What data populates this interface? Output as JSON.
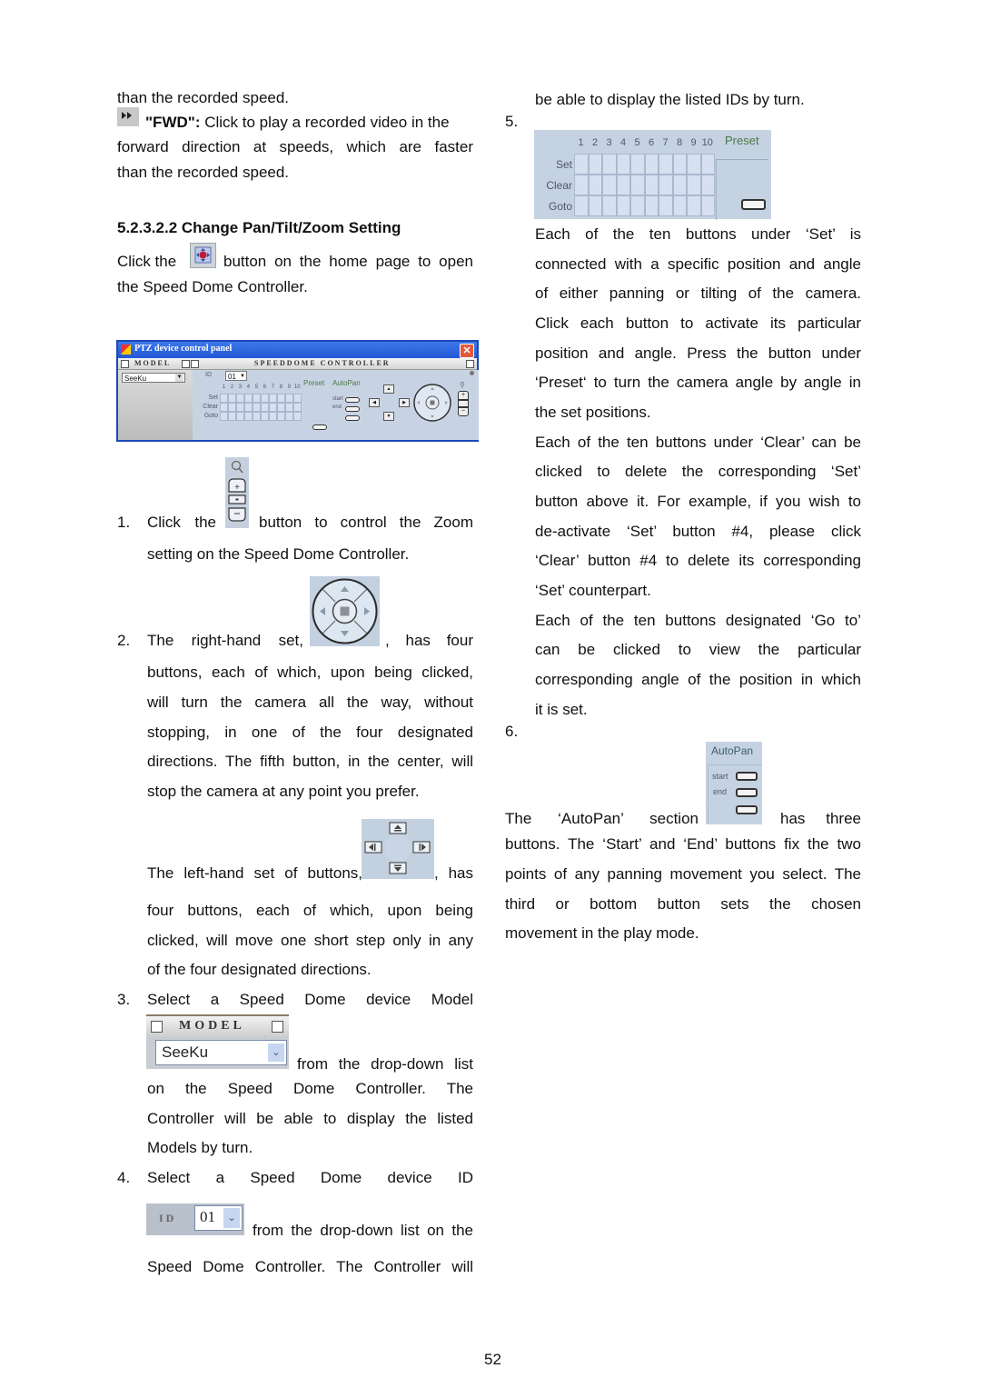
{
  "left_column": {
    "intro_line1": "than the recorded speed.",
    "fwd_label": "\"FWD\":",
    "fwd_line1_rest": " Click to play a recorded video in the",
    "fwd_line2": "forward direction at speeds, which are faster",
    "fwd_line3": "than the recorded speed.",
    "section_heading": "5.2.3.2.2 Change Pan/Tilt/Zoom Setting",
    "click_line1_a": "Click the",
    "click_line1_b": "button on the home page to open",
    "click_line2": "the Speed Dome Controller.",
    "ptz_panel": {
      "window_title": "PTZ device control panel",
      "close_glyph": "✕",
      "model_header": "MODEL",
      "controller_header": "SPEEDDOME CONTROLLER",
      "model_value": "SeeKu",
      "id_label": "ID",
      "id_value": "01",
      "numbers": [
        "1",
        "2",
        "3",
        "4",
        "5",
        "6",
        "7",
        "8",
        "9",
        "10"
      ],
      "row_labels": [
        "Set",
        "Clear",
        "Goto"
      ],
      "preset_label": "Preset",
      "autopan_label": "AutoPan",
      "start_label": "start",
      "end_label": "end"
    },
    "item1": {
      "number": "1.",
      "text_a": "Click the",
      "text_b": "button to control the Zoom",
      "line2": "setting on the Speed Dome Controller."
    },
    "item2": {
      "number": "2.",
      "text_a": "The right-hand set,",
      "text_b": ", has four",
      "lines": [
        "buttons, each of which, upon being clicked,",
        "will turn the camera all the way, without",
        "stopping, in one of the four designated",
        "directions. The fifth button, in the center, will",
        "stop the camera at any point you prefer."
      ],
      "left_set_a": "The left-hand set of buttons,",
      "left_set_b": ", has",
      "left_lines": [
        "four buttons, each of which, upon being",
        "clicked, will move one short step only in any",
        "of the four designated directions."
      ]
    },
    "item3": {
      "number": "3.",
      "line1": "Select a Speed Dome device Model",
      "model_header": "MODEL",
      "model_value": "SeeKu",
      "after_image": "from the drop-down list",
      "lines": [
        "on the Speed Dome Controller. The",
        "Controller will be able to display the listed",
        "Models by turn."
      ]
    },
    "item4": {
      "number": "4.",
      "line1": "Select a Speed Dome device ID",
      "id_label": "ID",
      "id_value": "01",
      "after_image": "from the drop-down list on the",
      "line3": "Speed Dome Controller. The Controller will"
    }
  },
  "right_column": {
    "line_top": "be able to display the listed IDs by turn.",
    "item5_number": "5.",
    "preset_grid": {
      "numbers": [
        "1",
        "2",
        "3",
        "4",
        "5",
        "6",
        "7",
        "8",
        "9",
        "10"
      ],
      "row_labels": [
        "Set",
        "Clear",
        "Goto"
      ],
      "preset_label": "Preset"
    },
    "set_paragraph": [
      "Each of the ten buttons under ‘Set’ is",
      "connected with a specific position and angle",
      "of either panning or tilting of the camera.",
      "Click each button to activate its particular",
      "position and angle. Press the button under",
      "‘Preset‘ to turn the camera angle by angle in",
      "the set positions."
    ],
    "clear_paragraph": [
      "Each of the ten buttons under ‘Clear’ can be",
      "clicked to delete the corresponding ‘Set’",
      "button above it. For example, if you wish to",
      "de-activate ‘Set’ button #4, please click",
      "‘Clear’ button #4 to delete its corresponding",
      "‘Set’ counterpart."
    ],
    "goto_paragraph": [
      "Each of the ten buttons designated ‘Go to’",
      "can be clicked to view the particular",
      "corresponding angle of the position in which",
      "it is set."
    ],
    "item6_number": "6.",
    "autopan": {
      "label": "AutoPan",
      "start_label": "start",
      "end_label": "end"
    },
    "autopan_text_a": "The ‘AutoPan’ section",
    "autopan_text_b": "has three",
    "autopan_lines": [
      "buttons. The ‘Start’ and ‘End’ buttons fix the two",
      "points of any panning movement you select. The",
      "third or bottom button sets the chosen",
      "movement in the play mode."
    ]
  },
  "footer": {
    "page_number": "52"
  }
}
